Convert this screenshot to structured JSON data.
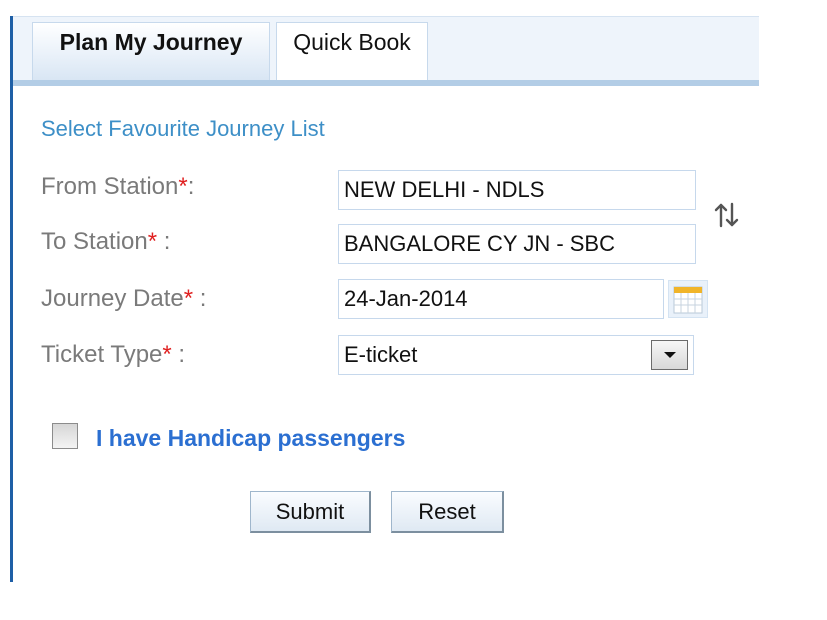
{
  "tabs": [
    {
      "label": "Plan My Journey",
      "active": true
    },
    {
      "label": "Quick Book",
      "active": false
    }
  ],
  "favourite_link": "Select Favourite Journey List",
  "form": {
    "from_label": "From Station",
    "to_label": "To Station",
    "date_label": "Journey Date",
    "ticket_label": "Ticket Type",
    "required_marker": "*",
    "from_value": "NEW DELHI - NDLS",
    "to_value": "BANGALORE CY JN - SBC",
    "date_value": "24-Jan-2014",
    "ticket_value": "E-ticket"
  },
  "handicap_label": "I have Handicap passengers",
  "handicap_checked": false,
  "buttons": {
    "submit": "Submit",
    "reset": "Reset"
  },
  "icons": {
    "swap": "swap-arrows-icon",
    "calendar": "calendar-icon",
    "dropdown": "chevron-down-icon"
  },
  "colors": {
    "accent": "#1e5fa6",
    "link": "#3d8fc7",
    "required": "#e02020",
    "checkbox_label": "#2b6fd1"
  }
}
